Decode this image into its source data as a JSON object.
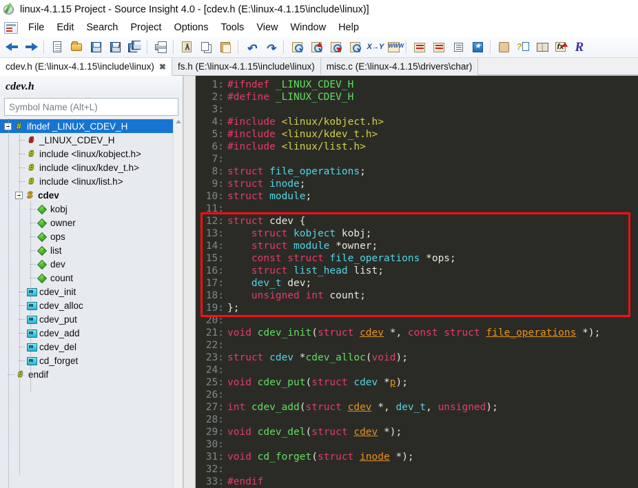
{
  "window": {
    "title": "linux-4.1.15 Project - Source Insight 4.0 - [cdev.h (E:\\linux-4.1.15\\include\\linux)]",
    "app_icon": "source-insight-logo-icon"
  },
  "menubar": {
    "doc_icon": "document-properties-icon",
    "items": [
      {
        "label": "File"
      },
      {
        "label": "Edit"
      },
      {
        "label": "Search"
      },
      {
        "label": "Project"
      },
      {
        "label": "Options"
      },
      {
        "label": "Tools"
      },
      {
        "label": "View"
      },
      {
        "label": "Window"
      },
      {
        "label": "Help"
      }
    ]
  },
  "toolbar": {
    "groups": [
      {
        "buttons": [
          {
            "name": "back-icon",
            "title": "Back"
          },
          {
            "name": "forward-icon",
            "title": "Forward"
          }
        ]
      },
      {
        "buttons": [
          {
            "name": "new-file-icon",
            "title": "New File"
          },
          {
            "name": "open-file-icon",
            "title": "Open File"
          },
          {
            "name": "save-icon",
            "title": "Save"
          },
          {
            "name": "save-as-icon",
            "title": "Save As"
          },
          {
            "name": "save-all-icon",
            "title": "Save All"
          }
        ]
      },
      {
        "buttons": [
          {
            "name": "print-icon",
            "title": "Print"
          }
        ]
      },
      {
        "buttons": [
          {
            "name": "cut-icon",
            "title": "Cut"
          },
          {
            "name": "copy-icon",
            "title": "Copy"
          },
          {
            "name": "paste-icon",
            "title": "Paste"
          }
        ]
      },
      {
        "buttons": [
          {
            "name": "undo-icon",
            "title": "Undo"
          },
          {
            "name": "redo-icon",
            "title": "Redo"
          }
        ]
      },
      {
        "buttons": [
          {
            "name": "search-icon",
            "title": "Search"
          },
          {
            "name": "search-backward-icon",
            "title": "Search Backward"
          },
          {
            "name": "search-forward-icon",
            "title": "Search Forward"
          },
          {
            "name": "search-files-icon",
            "title": "Search In Files"
          },
          {
            "name": "replace-icon",
            "title": "Replace"
          },
          {
            "name": "browse-web-icon",
            "title": "Browse Web"
          }
        ]
      },
      {
        "buttons": [
          {
            "name": "jump-to-definition-icon",
            "title": "Jump To Definition"
          },
          {
            "name": "jump-back-icon",
            "title": "Jump Back"
          },
          {
            "name": "context-window-icon",
            "title": "Context Window"
          },
          {
            "name": "bookmark-icon",
            "title": "Bookmark"
          }
        ]
      },
      {
        "buttons": [
          {
            "name": "smart-rename-icon",
            "title": "Smart Rename"
          },
          {
            "name": "help-topic-icon",
            "title": "Help Topic"
          },
          {
            "name": "reference-icon",
            "title": "Reference"
          },
          {
            "name": "function-up-icon",
            "title": "Function"
          },
          {
            "name": "relation-window-icon",
            "title": "Relation Window"
          }
        ]
      }
    ],
    "undo_glyph": "↶",
    "redo_glyph": "↷",
    "xy_label": "X→Y",
    "www_label": "WWW",
    "fx_label": "fx",
    "r_label": "R",
    "help_glyph": "?"
  },
  "tabs": {
    "close_glyph": "✖",
    "items": [
      {
        "label": "cdev.h (E:\\linux-4.1.15\\include\\linux)",
        "active": true,
        "closable": true
      },
      {
        "label": "fs.h (E:\\linux-4.1.15\\include\\linux)",
        "active": false,
        "closable": false
      },
      {
        "label": "misc.c (E:\\linux-4.1.15\\drivers\\char)",
        "active": false,
        "closable": false
      }
    ]
  },
  "left_panel": {
    "title": "cdev.h",
    "symbol_input_placeholder": "Symbol Name (Alt+L)",
    "symbol_input_value": "",
    "tree": [
      {
        "label": "ifndef _LINUX_CDEV_H",
        "icon": "preprocessor-hash-icon",
        "depth": 0,
        "expander": "minus",
        "selected": true,
        "bold": false
      },
      {
        "label": "_LINUX_CDEV_H",
        "icon": "macro-hash-red-icon",
        "depth": 1,
        "expander": "none",
        "selected": false,
        "bold": false
      },
      {
        "label": "include <linux/kobject.h>",
        "icon": "preprocessor-hash-icon",
        "depth": 1,
        "expander": "none",
        "selected": false,
        "bold": false
      },
      {
        "label": "include <linux/kdev_t.h>",
        "icon": "preprocessor-hash-icon",
        "depth": 1,
        "expander": "none",
        "selected": false,
        "bold": false
      },
      {
        "label": "include <linux/list.h>",
        "icon": "preprocessor-hash-icon",
        "depth": 1,
        "expander": "none",
        "selected": false,
        "bold": false
      },
      {
        "label": "cdev",
        "icon": "struct-icon",
        "depth": 1,
        "expander": "minus",
        "selected": false,
        "bold": true
      },
      {
        "label": "kobj",
        "icon": "member-icon",
        "depth": 2,
        "expander": "none",
        "selected": false,
        "bold": false
      },
      {
        "label": "owner",
        "icon": "member-icon",
        "depth": 2,
        "expander": "none",
        "selected": false,
        "bold": false
      },
      {
        "label": "ops",
        "icon": "member-icon",
        "depth": 2,
        "expander": "none",
        "selected": false,
        "bold": false
      },
      {
        "label": "list",
        "icon": "member-icon",
        "depth": 2,
        "expander": "none",
        "selected": false,
        "bold": false
      },
      {
        "label": "dev",
        "icon": "member-icon",
        "depth": 2,
        "expander": "none",
        "selected": false,
        "bold": false
      },
      {
        "label": "count",
        "icon": "member-icon",
        "depth": 2,
        "expander": "none",
        "selected": false,
        "bold": false
      },
      {
        "label": "cdev_init",
        "icon": "function-icon",
        "depth": 1,
        "expander": "none",
        "selected": false,
        "bold": false
      },
      {
        "label": "cdev_alloc",
        "icon": "function-icon",
        "depth": 1,
        "expander": "none",
        "selected": false,
        "bold": false
      },
      {
        "label": "cdev_put",
        "icon": "function-icon",
        "depth": 1,
        "expander": "none",
        "selected": false,
        "bold": false
      },
      {
        "label": "cdev_add",
        "icon": "function-icon",
        "depth": 1,
        "expander": "none",
        "selected": false,
        "bold": false
      },
      {
        "label": "cdev_del",
        "icon": "function-icon",
        "depth": 1,
        "expander": "none",
        "selected": false,
        "bold": false
      },
      {
        "label": "cd_forget",
        "icon": "function-icon",
        "depth": 1,
        "expander": "none",
        "selected": false,
        "bold": false
      },
      {
        "label": "endif",
        "icon": "preprocessor-hash-icon",
        "depth": 0,
        "expander": "none",
        "selected": false,
        "bold": false
      }
    ]
  },
  "editor": {
    "background_color": "#2b2b26",
    "line_number_color": "#7d8a8a",
    "annotation": {
      "type": "rectangle",
      "color": "#fb0f0f",
      "covers_lines": [
        12,
        19
      ]
    },
    "lines": [
      {
        "n": 1,
        "tokens": [
          {
            "t": "#ifndef ",
            "c": "k-pre"
          },
          {
            "t": "_LINUX_CDEV_H",
            "c": "k-macro"
          }
        ]
      },
      {
        "n": 2,
        "tokens": [
          {
            "t": "#define ",
            "c": "k-pre"
          },
          {
            "t": "_LINUX_CDEV_H",
            "c": "k-macro"
          }
        ]
      },
      {
        "n": 3,
        "tokens": []
      },
      {
        "n": 4,
        "tokens": [
          {
            "t": "#include ",
            "c": "k-pre"
          },
          {
            "t": "<linux/kobject.h>",
            "c": "k-inc"
          }
        ]
      },
      {
        "n": 5,
        "tokens": [
          {
            "t": "#include ",
            "c": "k-pre"
          },
          {
            "t": "<linux/kdev_t.h>",
            "c": "k-inc"
          }
        ]
      },
      {
        "n": 6,
        "tokens": [
          {
            "t": "#include ",
            "c": "k-pre"
          },
          {
            "t": "<linux/list.h>",
            "c": "k-inc"
          }
        ]
      },
      {
        "n": 7,
        "tokens": []
      },
      {
        "n": 8,
        "tokens": [
          {
            "t": "struct ",
            "c": "k-kw"
          },
          {
            "t": "file_operations",
            "c": "k-type"
          },
          {
            "t": ";",
            "c": "k-plain"
          }
        ]
      },
      {
        "n": 9,
        "tokens": [
          {
            "t": "struct ",
            "c": "k-kw"
          },
          {
            "t": "inode",
            "c": "k-type"
          },
          {
            "t": ";",
            "c": "k-plain"
          }
        ]
      },
      {
        "n": 10,
        "tokens": [
          {
            "t": "struct ",
            "c": "k-kw"
          },
          {
            "t": "module",
            "c": "k-type"
          },
          {
            "t": ";",
            "c": "k-plain"
          }
        ]
      },
      {
        "n": 11,
        "tokens": []
      },
      {
        "n": 12,
        "tokens": [
          {
            "t": "struct ",
            "c": "k-kw"
          },
          {
            "t": "cdev {",
            "c": "k-plain"
          }
        ]
      },
      {
        "n": 13,
        "tokens": [
          {
            "t": "    ",
            "c": "k-plain"
          },
          {
            "t": "struct ",
            "c": "k-kw"
          },
          {
            "t": "kobject",
            "c": "k-type"
          },
          {
            "t": " kobj;",
            "c": "k-plain"
          }
        ]
      },
      {
        "n": 14,
        "tokens": [
          {
            "t": "    ",
            "c": "k-plain"
          },
          {
            "t": "struct ",
            "c": "k-kw"
          },
          {
            "t": "module",
            "c": "k-type"
          },
          {
            "t": " *owner;",
            "c": "k-plain"
          }
        ]
      },
      {
        "n": 15,
        "tokens": [
          {
            "t": "    ",
            "c": "k-plain"
          },
          {
            "t": "const struct ",
            "c": "k-kw"
          },
          {
            "t": "file_operations",
            "c": "k-type"
          },
          {
            "t": " *ops;",
            "c": "k-plain"
          }
        ]
      },
      {
        "n": 16,
        "tokens": [
          {
            "t": "    ",
            "c": "k-plain"
          },
          {
            "t": "struct ",
            "c": "k-kw"
          },
          {
            "t": "list_head",
            "c": "k-type"
          },
          {
            "t": " list;",
            "c": "k-plain"
          }
        ]
      },
      {
        "n": 17,
        "tokens": [
          {
            "t": "    ",
            "c": "k-plain"
          },
          {
            "t": "dev_t",
            "c": "k-type"
          },
          {
            "t": " dev;",
            "c": "k-plain"
          }
        ]
      },
      {
        "n": 18,
        "tokens": [
          {
            "t": "    ",
            "c": "k-plain"
          },
          {
            "t": "unsigned int",
            "c": "k-kw"
          },
          {
            "t": " count;",
            "c": "k-plain"
          }
        ]
      },
      {
        "n": 19,
        "tokens": [
          {
            "t": "};",
            "c": "k-plain"
          }
        ]
      },
      {
        "n": 20,
        "tokens": []
      },
      {
        "n": 21,
        "tokens": [
          {
            "t": "void ",
            "c": "k-kw"
          },
          {
            "t": "cdev_init",
            "c": "k-fn"
          },
          {
            "t": "(",
            "c": "k-plain"
          },
          {
            "t": "struct ",
            "c": "k-kw"
          },
          {
            "t": "cdev",
            "c": "k-link"
          },
          {
            "t": " *, ",
            "c": "k-plain"
          },
          {
            "t": "const struct ",
            "c": "k-kw"
          },
          {
            "t": "file_operations",
            "c": "k-link"
          },
          {
            "t": " *);",
            "c": "k-plain"
          }
        ]
      },
      {
        "n": 22,
        "tokens": []
      },
      {
        "n": 23,
        "tokens": [
          {
            "t": "struct ",
            "c": "k-kw"
          },
          {
            "t": "cdev",
            "c": "k-type"
          },
          {
            "t": " *",
            "c": "k-plain"
          },
          {
            "t": "cdev_alloc",
            "c": "k-fn"
          },
          {
            "t": "(",
            "c": "k-plain"
          },
          {
            "t": "void",
            "c": "k-kw"
          },
          {
            "t": ");",
            "c": "k-plain"
          }
        ]
      },
      {
        "n": 24,
        "tokens": []
      },
      {
        "n": 25,
        "tokens": [
          {
            "t": "void ",
            "c": "k-kw"
          },
          {
            "t": "cdev_put",
            "c": "k-fn"
          },
          {
            "t": "(",
            "c": "k-plain"
          },
          {
            "t": "struct ",
            "c": "k-kw"
          },
          {
            "t": "cdev",
            "c": "k-type"
          },
          {
            "t": " *",
            "c": "k-plain"
          },
          {
            "t": "p",
            "c": "k-link"
          },
          {
            "t": ");",
            "c": "k-plain"
          }
        ]
      },
      {
        "n": 26,
        "tokens": []
      },
      {
        "n": 27,
        "tokens": [
          {
            "t": "int ",
            "c": "k-kw"
          },
          {
            "t": "cdev_add",
            "c": "k-fn"
          },
          {
            "t": "(",
            "c": "k-plain"
          },
          {
            "t": "struct ",
            "c": "k-kw"
          },
          {
            "t": "cdev",
            "c": "k-link"
          },
          {
            "t": " *, ",
            "c": "k-plain"
          },
          {
            "t": "dev_t",
            "c": "k-type"
          },
          {
            "t": ", ",
            "c": "k-plain"
          },
          {
            "t": "unsigned",
            "c": "k-kw"
          },
          {
            "t": ");",
            "c": "k-plain"
          }
        ]
      },
      {
        "n": 28,
        "tokens": []
      },
      {
        "n": 29,
        "tokens": [
          {
            "t": "void ",
            "c": "k-kw"
          },
          {
            "t": "cdev_del",
            "c": "k-fn"
          },
          {
            "t": "(",
            "c": "k-plain"
          },
          {
            "t": "struct ",
            "c": "k-kw"
          },
          {
            "t": "cdev",
            "c": "k-link"
          },
          {
            "t": " *);",
            "c": "k-plain"
          }
        ]
      },
      {
        "n": 30,
        "tokens": []
      },
      {
        "n": 31,
        "tokens": [
          {
            "t": "void ",
            "c": "k-kw"
          },
          {
            "t": "cd_forget",
            "c": "k-fn"
          },
          {
            "t": "(",
            "c": "k-plain"
          },
          {
            "t": "struct ",
            "c": "k-kw"
          },
          {
            "t": "inode",
            "c": "k-link"
          },
          {
            "t": " *);",
            "c": "k-plain"
          }
        ]
      },
      {
        "n": 32,
        "tokens": []
      },
      {
        "n": 33,
        "tokens": [
          {
            "t": "#endif",
            "c": "k-pre"
          }
        ]
      }
    ]
  }
}
